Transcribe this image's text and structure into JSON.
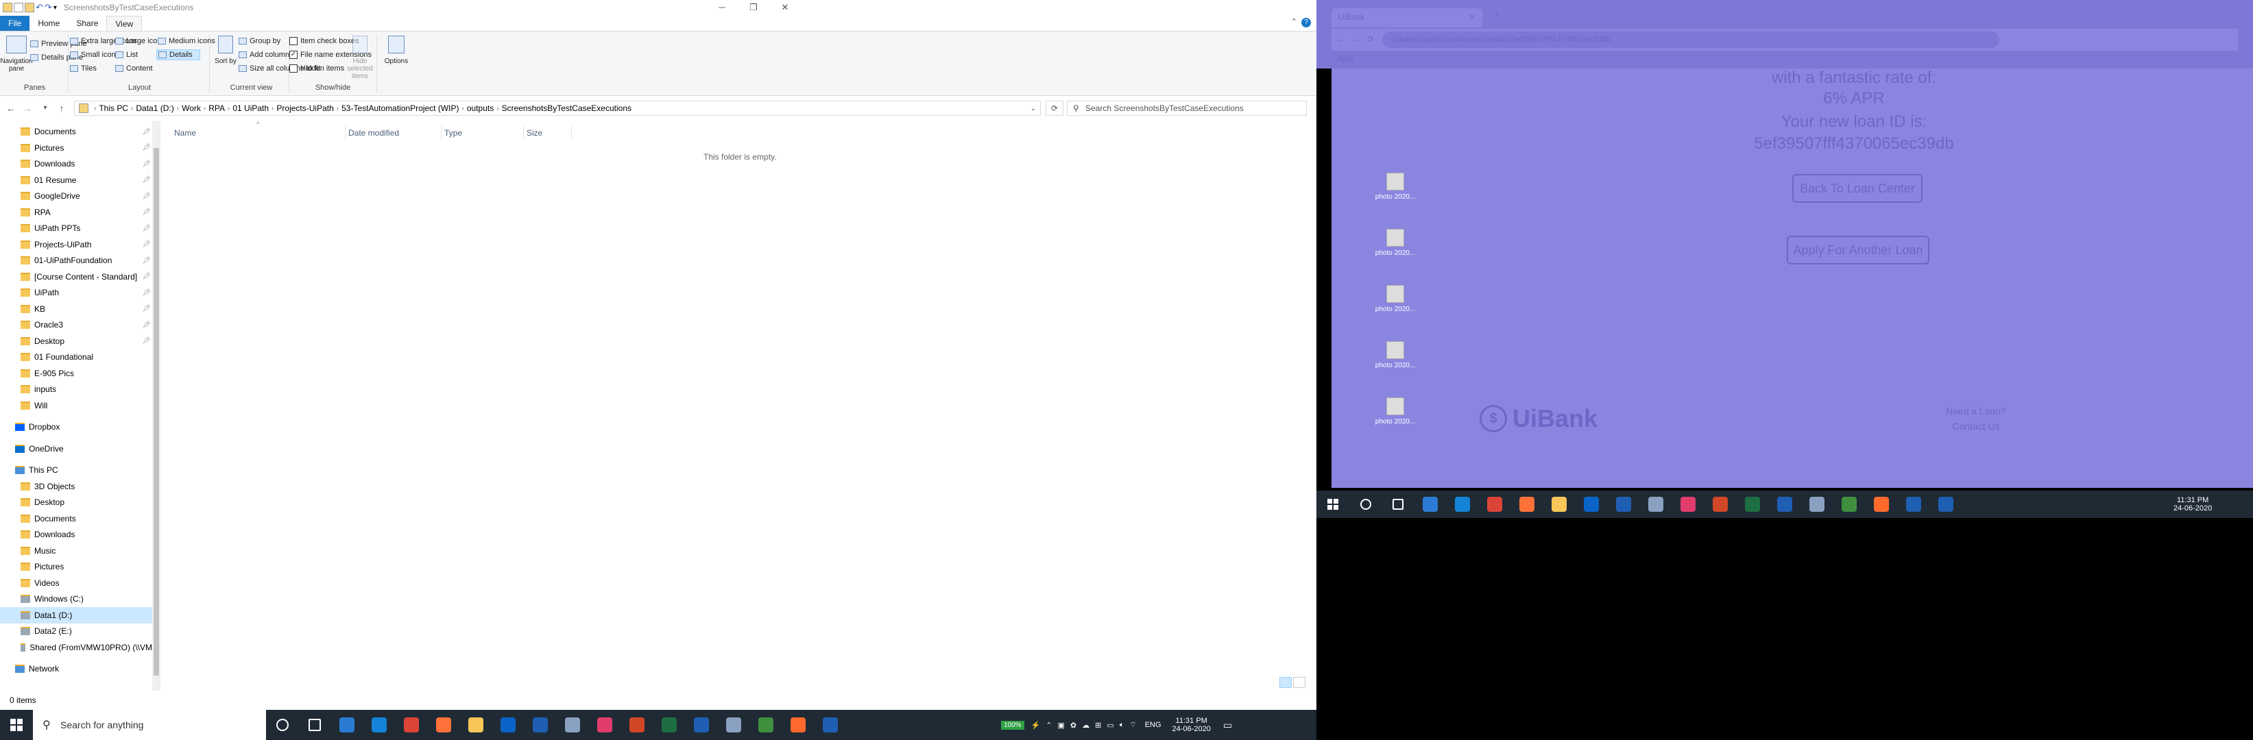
{
  "explorer": {
    "title": "ScreenshotsByTestCaseExecutions",
    "tabs": {
      "file": "File",
      "home": "Home",
      "share": "Share",
      "view": "View"
    },
    "ribbon": {
      "panes": {
        "navigation_pane": "Navigation pane",
        "preview_pane": "Preview pane",
        "details_pane": "Details pane",
        "label": "Panes"
      },
      "layout": {
        "extra_large": "Extra large icons",
        "large": "Large icons",
        "medium": "Medium icons",
        "small": "Small icons",
        "list": "List",
        "details": "Details",
        "tiles": "Tiles",
        "content": "Content",
        "label": "Layout"
      },
      "current_view": {
        "sort_by": "Sort by",
        "group_by": "Group by",
        "add_columns": "Add columns",
        "size_all": "Size all columns to fit",
        "label": "Current view"
      },
      "show_hide": {
        "item_check_boxes": "Item check boxes",
        "file_name_extensions": "File name extensions",
        "hidden_items": "Hidden items",
        "hide_selected": "Hide selected items",
        "options": "Options",
        "label": "Show/hide"
      }
    },
    "breadcrumb": [
      "This PC",
      "Data1 (D:)",
      "Work",
      "RPA",
      "01 UiPath",
      "Projects-UiPath",
      "53-TestAutomationProject (WIP)",
      "outputs",
      "ScreenshotsByTestCaseExecutions"
    ],
    "search_placeholder": "Search ScreenshotsByTestCaseExecutions",
    "nav_items": [
      {
        "label": "Documents",
        "pinned": true
      },
      {
        "label": "Pictures",
        "pinned": true
      },
      {
        "label": "Downloads",
        "pinned": true
      },
      {
        "label": "01 Resume",
        "pinned": true
      },
      {
        "label": "GoogleDrive",
        "pinned": true
      },
      {
        "label": "RPA",
        "pinned": true
      },
      {
        "label": "UiPath PPTs",
        "pinned": true
      },
      {
        "label": "Projects-UiPath",
        "pinned": true
      },
      {
        "label": "01-UiPathFoundation",
        "pinned": true
      },
      {
        "label": "[Course Content - Standard]",
        "pinned": true
      },
      {
        "label": "UiPath",
        "pinned": true
      },
      {
        "label": "KB",
        "pinned": true
      },
      {
        "label": "Oracle3",
        "pinned": true
      },
      {
        "label": "Desktop",
        "pinned": true
      },
      {
        "label": "01 Foundational",
        "pinned": false
      },
      {
        "label": "E-905 Pics",
        "pinned": false
      },
      {
        "label": "inputs",
        "pinned": false
      },
      {
        "label": "Will",
        "pinned": false
      }
    ],
    "dropbox": "Dropbox",
    "onedrive": "OneDrive",
    "this_pc": "This PC",
    "pc_items": [
      "3D Objects",
      "Desktop",
      "Documents",
      "Downloads",
      "Music",
      "Pictures",
      "Videos",
      "Windows (C:)",
      "Data1 (D:)",
      "Data2 (E:)",
      "Shared (FromVMW10PRO) (\\\\VM"
    ],
    "network": "Network",
    "columns": [
      "Name",
      "Date modified",
      "Type",
      "Size"
    ],
    "empty_text": "This folder is empty.",
    "status": "0 items"
  },
  "taskbar1": {
    "search_placeholder": "Search for anything",
    "battery": "100%",
    "lang": "ENG",
    "time": "11:31 PM",
    "date": "24-06-2020"
  },
  "browser": {
    "tab_title": "UiBank",
    "url": "uibank.uipath.com/loans/results/5ef39507fff4370065ec39db",
    "apps": "Apps",
    "rate_line": "with a fantastic rate of:",
    "apr": "6% APR",
    "loan_line": "Your new loan ID is:",
    "loan_id": "5ef39507fff4370065ec39db",
    "btn_back": "Back To Loan Center",
    "btn_apply": "Apply For Another Loan",
    "brand": "UiBank",
    "need_loan": "Need a Loan?",
    "contact": "Contact Us",
    "desktop_icons": [
      "photo 2020...",
      "photo 2020...",
      "photo 2020...",
      "photo 2020...",
      "photo 2020..."
    ]
  },
  "taskbar2": {
    "time": "11:31 PM",
    "date": "24-06-2020"
  },
  "colors": {
    "accent": "#1979ca",
    "overlay": "#8a86e0",
    "taskbar": "#1f2a35"
  }
}
